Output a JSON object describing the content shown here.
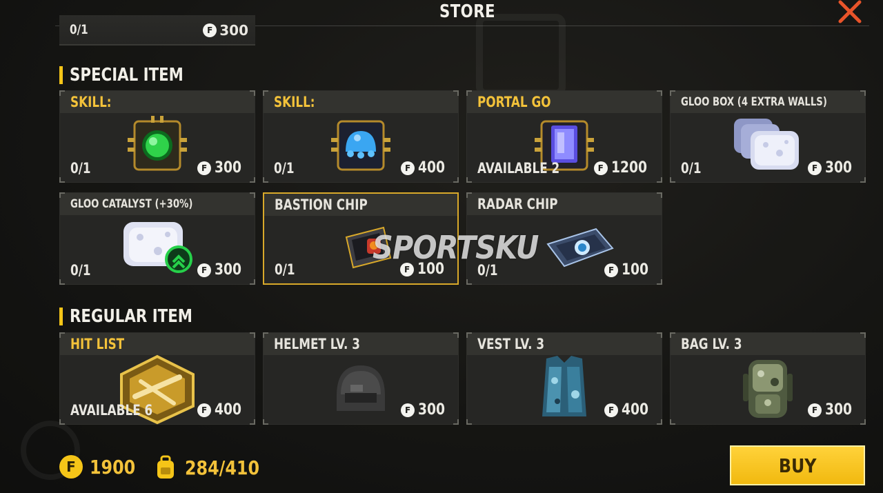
{
  "header": {
    "title": "STORE",
    "close_icon": "close-icon"
  },
  "partial_row": {
    "qty": "0/1",
    "price": "300"
  },
  "sections": {
    "special": "SPECIAL ITEM",
    "regular": "REGULAR ITEM"
  },
  "special_items": [
    {
      "name": "SKILL:",
      "qty": "0/1",
      "price": "300",
      "icon": "green-skill-chip-icon"
    },
    {
      "name": "SKILL:",
      "qty": "0/1",
      "price": "400",
      "icon": "blue-skill-chip-icon"
    },
    {
      "name": "PORTAL GO",
      "qty": "AVAILABLE 2",
      "price": "1200",
      "icon": "portal-chip-icon"
    },
    {
      "name": "GLOO BOX (4 EXTRA WALLS)",
      "qty": "0/1",
      "price": "300",
      "icon": "gloo-wall-icon"
    },
    {
      "name": "GLOO CATALYST (+30%)",
      "qty": "0/1",
      "price": "300",
      "icon": "gloo-catalyst-icon"
    },
    {
      "name": "BASTION CHIP",
      "qty": "0/1",
      "price": "100",
      "icon": "bastion-chip-icon"
    },
    {
      "name": "RADAR CHIP",
      "qty": "0/1",
      "price": "100",
      "icon": "radar-chip-icon"
    }
  ],
  "regular_items": [
    {
      "name": "HIT LIST",
      "qty": "AVAILABLE 6",
      "price": "400",
      "icon": "hit-list-badge-icon"
    },
    {
      "name": "HELMET LV. 3",
      "qty": "",
      "price": "300",
      "icon": "helmet-icon"
    },
    {
      "name": "VEST LV. 3",
      "qty": "",
      "price": "400",
      "icon": "vest-icon"
    },
    {
      "name": "BAG LV. 3",
      "qty": "",
      "price": "300",
      "icon": "backpack-icon"
    }
  ],
  "currency_symbol": "F",
  "watermark": "SPORTSKU",
  "footer": {
    "coins": "1900",
    "capacity": "284/410",
    "buy_label": "BUY"
  },
  "colors": {
    "accent": "#f5c518",
    "gold_text": "#f3c23a",
    "close": "#e8542a",
    "card_bg": "#262624"
  }
}
